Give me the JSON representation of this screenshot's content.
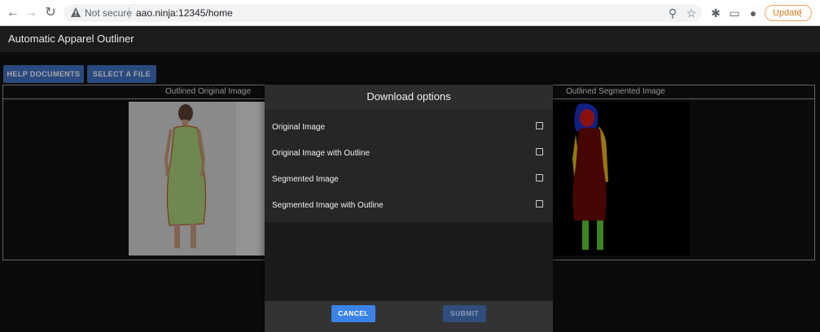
{
  "browser": {
    "secure_label": "Not secure",
    "url": "aao.ninja:12345/home",
    "update_label": "Update"
  },
  "app": {
    "title": "Automatic Apparel Outliner"
  },
  "toolbar": {
    "help_label": "HELP DOCUMENTS",
    "select_label": "SELECT A FILE"
  },
  "panel": {
    "original_header": "Outlined Original Image",
    "segmented_header": "Outlined Segmented Image"
  },
  "dialog": {
    "title": "Download options",
    "options": [
      {
        "label": "Original Image",
        "checked": false
      },
      {
        "label": "Original Image with Outline",
        "checked": false
      },
      {
        "label": "Segmented Image",
        "checked": false
      },
      {
        "label": "Segmented Image with Outline",
        "checked": false
      }
    ],
    "cancel_label": "CANCEL",
    "submit_label": "SUBMIT"
  },
  "colors": {
    "primary_button": "#3f70c4",
    "cancel_button": "#3b83e8",
    "submit_button_disabled": "#2f4e7e",
    "update_accent": "#d97a1f"
  }
}
